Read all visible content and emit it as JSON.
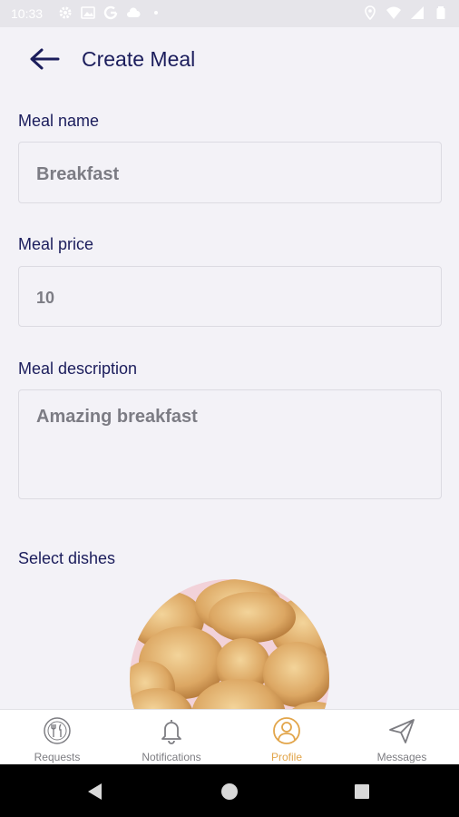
{
  "status_bar": {
    "time": "10:33",
    "left_icons": [
      "gear-icon",
      "image-icon",
      "google-icon",
      "cloud-icon",
      "dot-icon"
    ],
    "right_icons": [
      "location-icon",
      "wifi-icon",
      "signal-icon",
      "battery-icon"
    ]
  },
  "header": {
    "title": "Create Meal",
    "back_icon": "arrow-left-icon"
  },
  "form": {
    "meal_name": {
      "label": "Meal name",
      "value": "Breakfast"
    },
    "meal_price": {
      "label": "Meal price",
      "value": "10"
    },
    "meal_description": {
      "label": "Meal description",
      "value": "Amazing breakfast"
    },
    "select_dishes": {
      "label": "Select dishes"
    }
  },
  "bottom_nav": {
    "items": [
      {
        "label": "Requests",
        "icon": "utensils-icon",
        "active": false
      },
      {
        "label": "Notifications",
        "icon": "bell-icon",
        "active": false
      },
      {
        "label": "Profile",
        "icon": "user-icon",
        "active": true
      },
      {
        "label": "Messages",
        "icon": "send-icon",
        "active": false
      }
    ],
    "active_color": "#e2a54a",
    "inactive_color": "#7d7d82"
  },
  "colors": {
    "primary_text": "#1b1d5c",
    "background": "#f3f2f7"
  }
}
